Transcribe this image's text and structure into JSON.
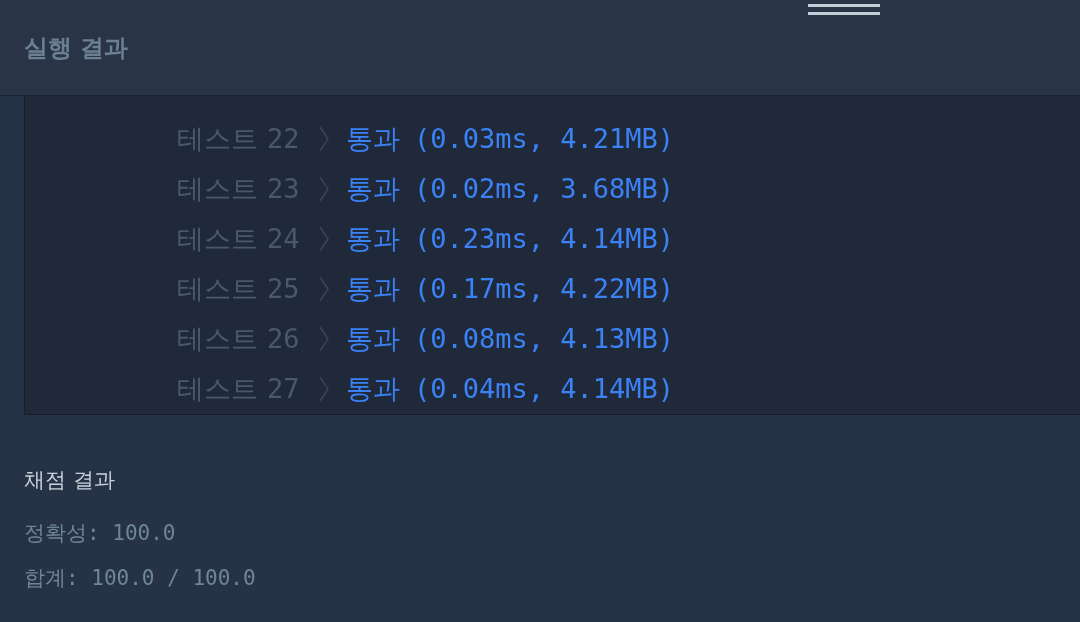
{
  "header": {
    "title": "실행 결과"
  },
  "tests": [
    {
      "label": "테스트",
      "number": "22",
      "kind": "pass",
      "result": "통과",
      "detail": "(0.03ms, 4.21MB)"
    },
    {
      "label": "테스트",
      "number": "23",
      "kind": "pass",
      "result": "통과",
      "detail": "(0.02ms, 3.68MB)"
    },
    {
      "label": "테스트",
      "number": "24",
      "kind": "pass",
      "result": "통과",
      "detail": "(0.23ms, 4.14MB)"
    },
    {
      "label": "테스트",
      "number": "25",
      "kind": "pass",
      "result": "통과",
      "detail": "(0.17ms, 4.22MB)"
    },
    {
      "label": "테스트",
      "number": "26",
      "kind": "pass",
      "result": "통과",
      "detail": "(0.08ms, 4.13MB)"
    },
    {
      "label": "테스트",
      "number": "27",
      "kind": "pass",
      "result": "통과",
      "detail": "(0.04ms, 4.14MB)"
    }
  ],
  "grading": {
    "title": "채점 결과",
    "accuracy": "정확성: 100.0",
    "total": "합계: 100.0 / 100.0"
  }
}
